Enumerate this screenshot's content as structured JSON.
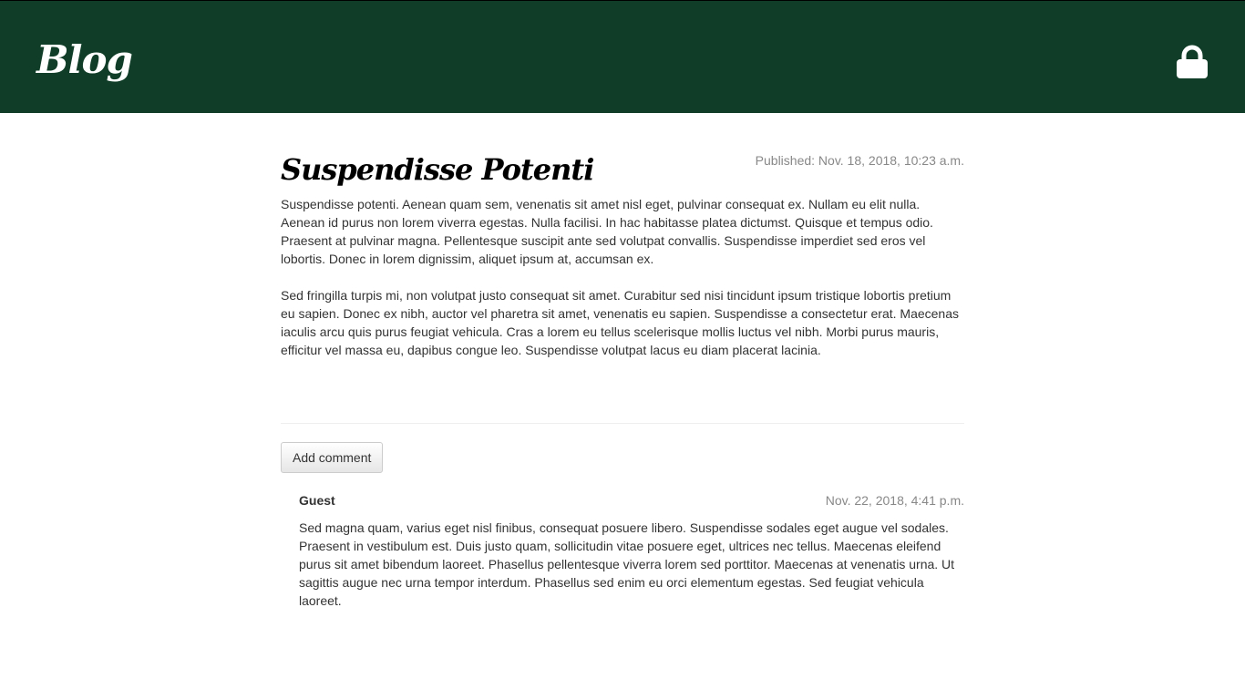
{
  "header": {
    "brand": "Blog",
    "lock_icon": "lock-icon",
    "background": "#0f3d27"
  },
  "post": {
    "title": "Suspendisse Potenti",
    "published": "Published: Nov. 18, 2018, 10:23 a.m.",
    "paragraphs": [
      "Suspendisse potenti. Aenean quam sem, venenatis sit amet nisl eget, pulvinar consequat ex. Nullam eu elit nulla. Aenean id purus non lorem viverra egestas. Nulla facilisi. In hac habitasse platea dictumst. Quisque et tempus odio. Praesent at pulvinar magna. Pellentesque suscipit ante sed volutpat convallis. Suspendisse imperdiet sed eros vel lobortis. Donec in lorem dignissim, aliquet ipsum at, accumsan ex.",
      "Sed fringilla turpis mi, non volutpat justo consequat sit amet. Curabitur sed nisi tincidunt ipsum tristique lobortis pretium eu sapien. Donec ex nibh, auctor vel pharetra sit amet, venenatis eu sapien. Suspendisse a consectetur erat. Maecenas iaculis arcu quis purus feugiat vehicula. Cras a lorem eu tellus scelerisque mollis luctus vel nibh. Morbi purus mauris, efficitur vel massa eu, dapibus congue leo. Suspendisse volutpat lacus eu diam placerat lacinia."
    ]
  },
  "comments": {
    "add_label": "Add comment",
    "items": [
      {
        "author": "Guest",
        "date": "Nov. 22, 2018, 4:41 p.m.",
        "text": "Sed magna quam, varius eget nisl finibus, consequat posuere libero. Suspendisse sodales eget augue vel sodales. Praesent in vestibulum est. Duis justo quam, sollicitudin vitae posuere eget, ultrices nec tellus. Maecenas eleifend purus sit amet bibendum laoreet. Phasellus pellentesque viverra lorem sed porttitor. Maecenas at venenatis urna. Ut sagittis augue nec urna tempor interdum. Phasellus sed enim eu orci elementum egestas. Sed feugiat vehicula laoreet."
      }
    ]
  }
}
